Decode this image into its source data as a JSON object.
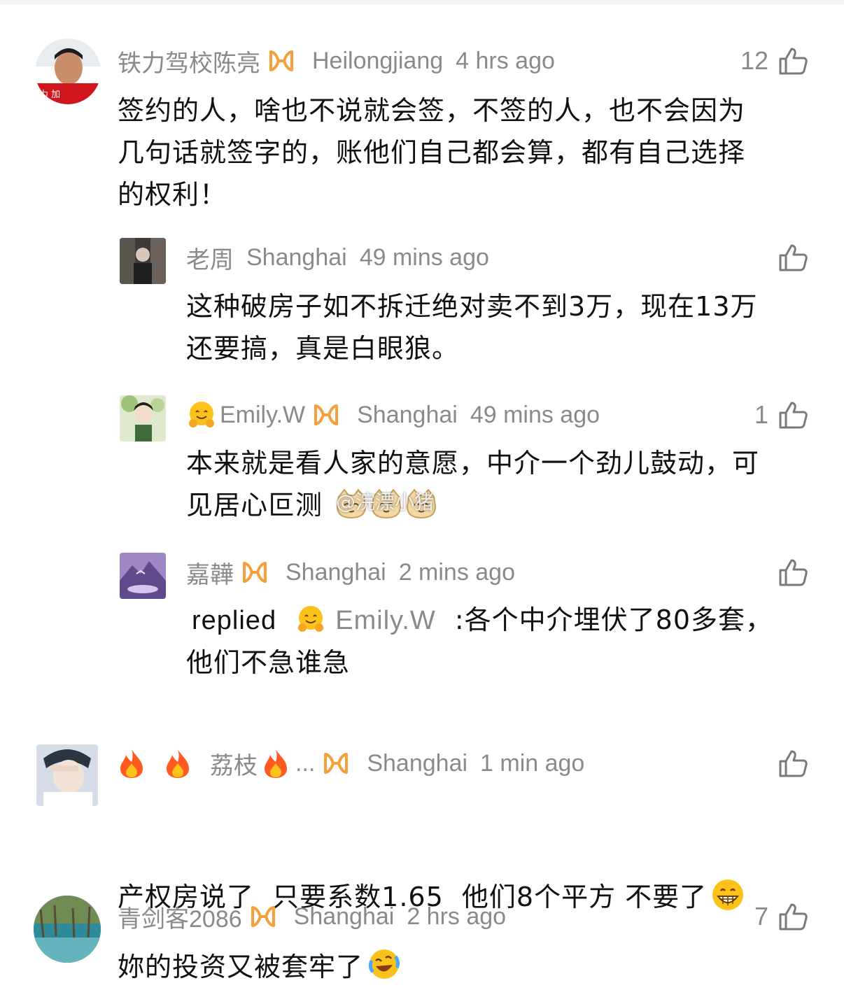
{
  "comments": [
    {
      "user": "铁力驾校陈亮",
      "location": "Heilongjiang",
      "time": "4 hrs ago",
      "likes": "12",
      "text_lines": [
        "签约的人，啥也不说就会签，不签的人，也不会因为",
        "几句话就签字的，账他们自己都会算，都有自己选择",
        "的权利！"
      ],
      "avatar_text": "力 加"
    },
    {
      "user": "老周",
      "location": "Shanghai",
      "time": "49 mins ago",
      "likes": "",
      "text_lines": [
        "这种破房子如不拆迁绝对卖不到3万，现在13万",
        "还要搞，真是白眼狼。"
      ]
    },
    {
      "user": "Emily.W",
      "location": "Shanghai",
      "time": "49 mins ago",
      "likes": "1",
      "text_lines": [
        "本来就是看人家的意愿，中介一个劲儿鼓动，可",
        "见居心叵测"
      ]
    },
    {
      "user": "嘉韡",
      "location": "Shanghai",
      "time": "2 mins ago",
      "likes": "",
      "reply_prefix": "replied",
      "reply_to": "Emily.W",
      "text_lines": [
        ":各个中介埋伏了80多套，",
        "他们不急谁急"
      ]
    },
    {
      "user": "荔枝",
      "user_suffix": "...",
      "location": "Shanghai",
      "time": "1 min ago",
      "likes": "",
      "text_lines": [
        "产权房说了  只要系数1.65  他们8个平方 不要了"
      ]
    },
    {
      "user": "青剑客2086",
      "location": "Shanghai",
      "time": "2 hrs ago",
      "likes": "7",
      "text_lines": [
        "妳的投资又被套牢了"
      ]
    }
  ],
  "watermark": "@浣漂小猪",
  "colors": {
    "meta": "#8a8a8a",
    "text": "#111111",
    "badge": "#f5a03a",
    "background": "#ffffff"
  },
  "icons": [
    "thumb-up-icon",
    "membership-badge-icon",
    "hug-emoji-icon",
    "fire-emoji-icon",
    "grin-emoji-icon",
    "laugh-cry-emoji-icon",
    "cat-emoji-icon"
  ]
}
